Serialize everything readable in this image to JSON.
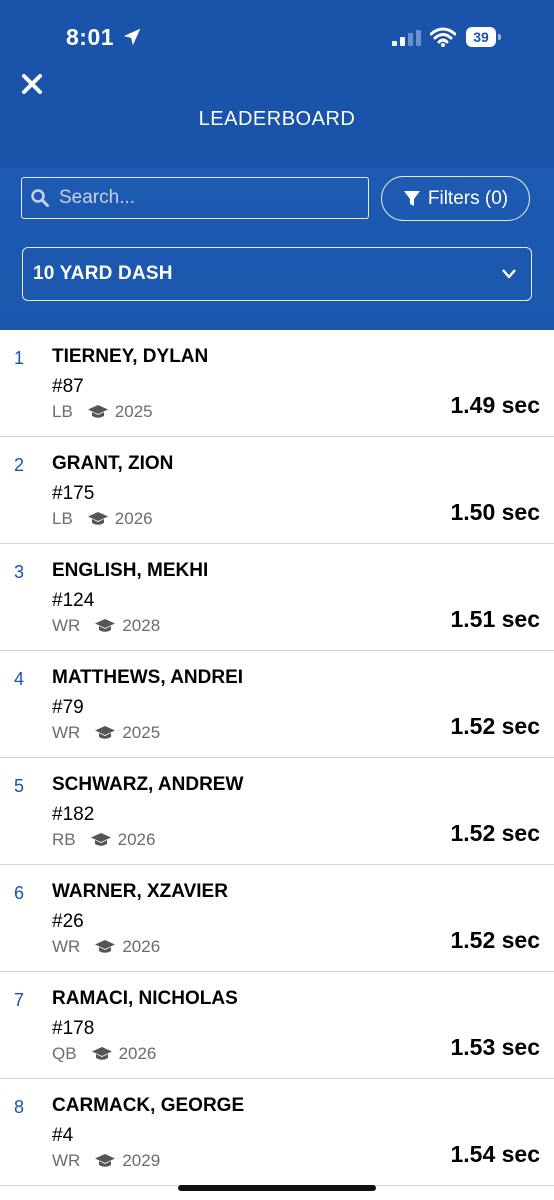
{
  "status_bar": {
    "time": "8:01",
    "battery": "39"
  },
  "header": {
    "title": "LEADERBOARD"
  },
  "search": {
    "placeholder": "Search..."
  },
  "filters": {
    "label": "Filters (0)"
  },
  "event": {
    "selected": "10 YARD DASH"
  },
  "colors": {
    "primary": "#1a53aa",
    "rank": "#1a53aa"
  },
  "rows": [
    {
      "rank": "1",
      "name": "TIERNEY, DYLAN",
      "jersey": "#87",
      "position": "LB",
      "class_year": "2025",
      "time": "1.49 sec"
    },
    {
      "rank": "2",
      "name": "GRANT, ZION",
      "jersey": "#175",
      "position": "LB",
      "class_year": "2026",
      "time": "1.50 sec"
    },
    {
      "rank": "3",
      "name": "ENGLISH, MEKHI",
      "jersey": "#124",
      "position": "WR",
      "class_year": "2028",
      "time": "1.51 sec"
    },
    {
      "rank": "4",
      "name": "MATTHEWS, ANDREI",
      "jersey": "#79",
      "position": "WR",
      "class_year": "2025",
      "time": "1.52 sec"
    },
    {
      "rank": "5",
      "name": "SCHWARZ, ANDREW",
      "jersey": "#182",
      "position": "RB",
      "class_year": "2026",
      "time": "1.52 sec"
    },
    {
      "rank": "6",
      "name": "WARNER, XZAVIER",
      "jersey": "#26",
      "position": "WR",
      "class_year": "2026",
      "time": "1.52 sec"
    },
    {
      "rank": "7",
      "name": "RAMACI, NICHOLAS",
      "jersey": "#178",
      "position": "QB",
      "class_year": "2026",
      "time": "1.53 sec"
    },
    {
      "rank": "8",
      "name": "CARMACK, GEORGE",
      "jersey": "#4",
      "position": "WR",
      "class_year": "2029",
      "time": "1.54 sec"
    }
  ]
}
